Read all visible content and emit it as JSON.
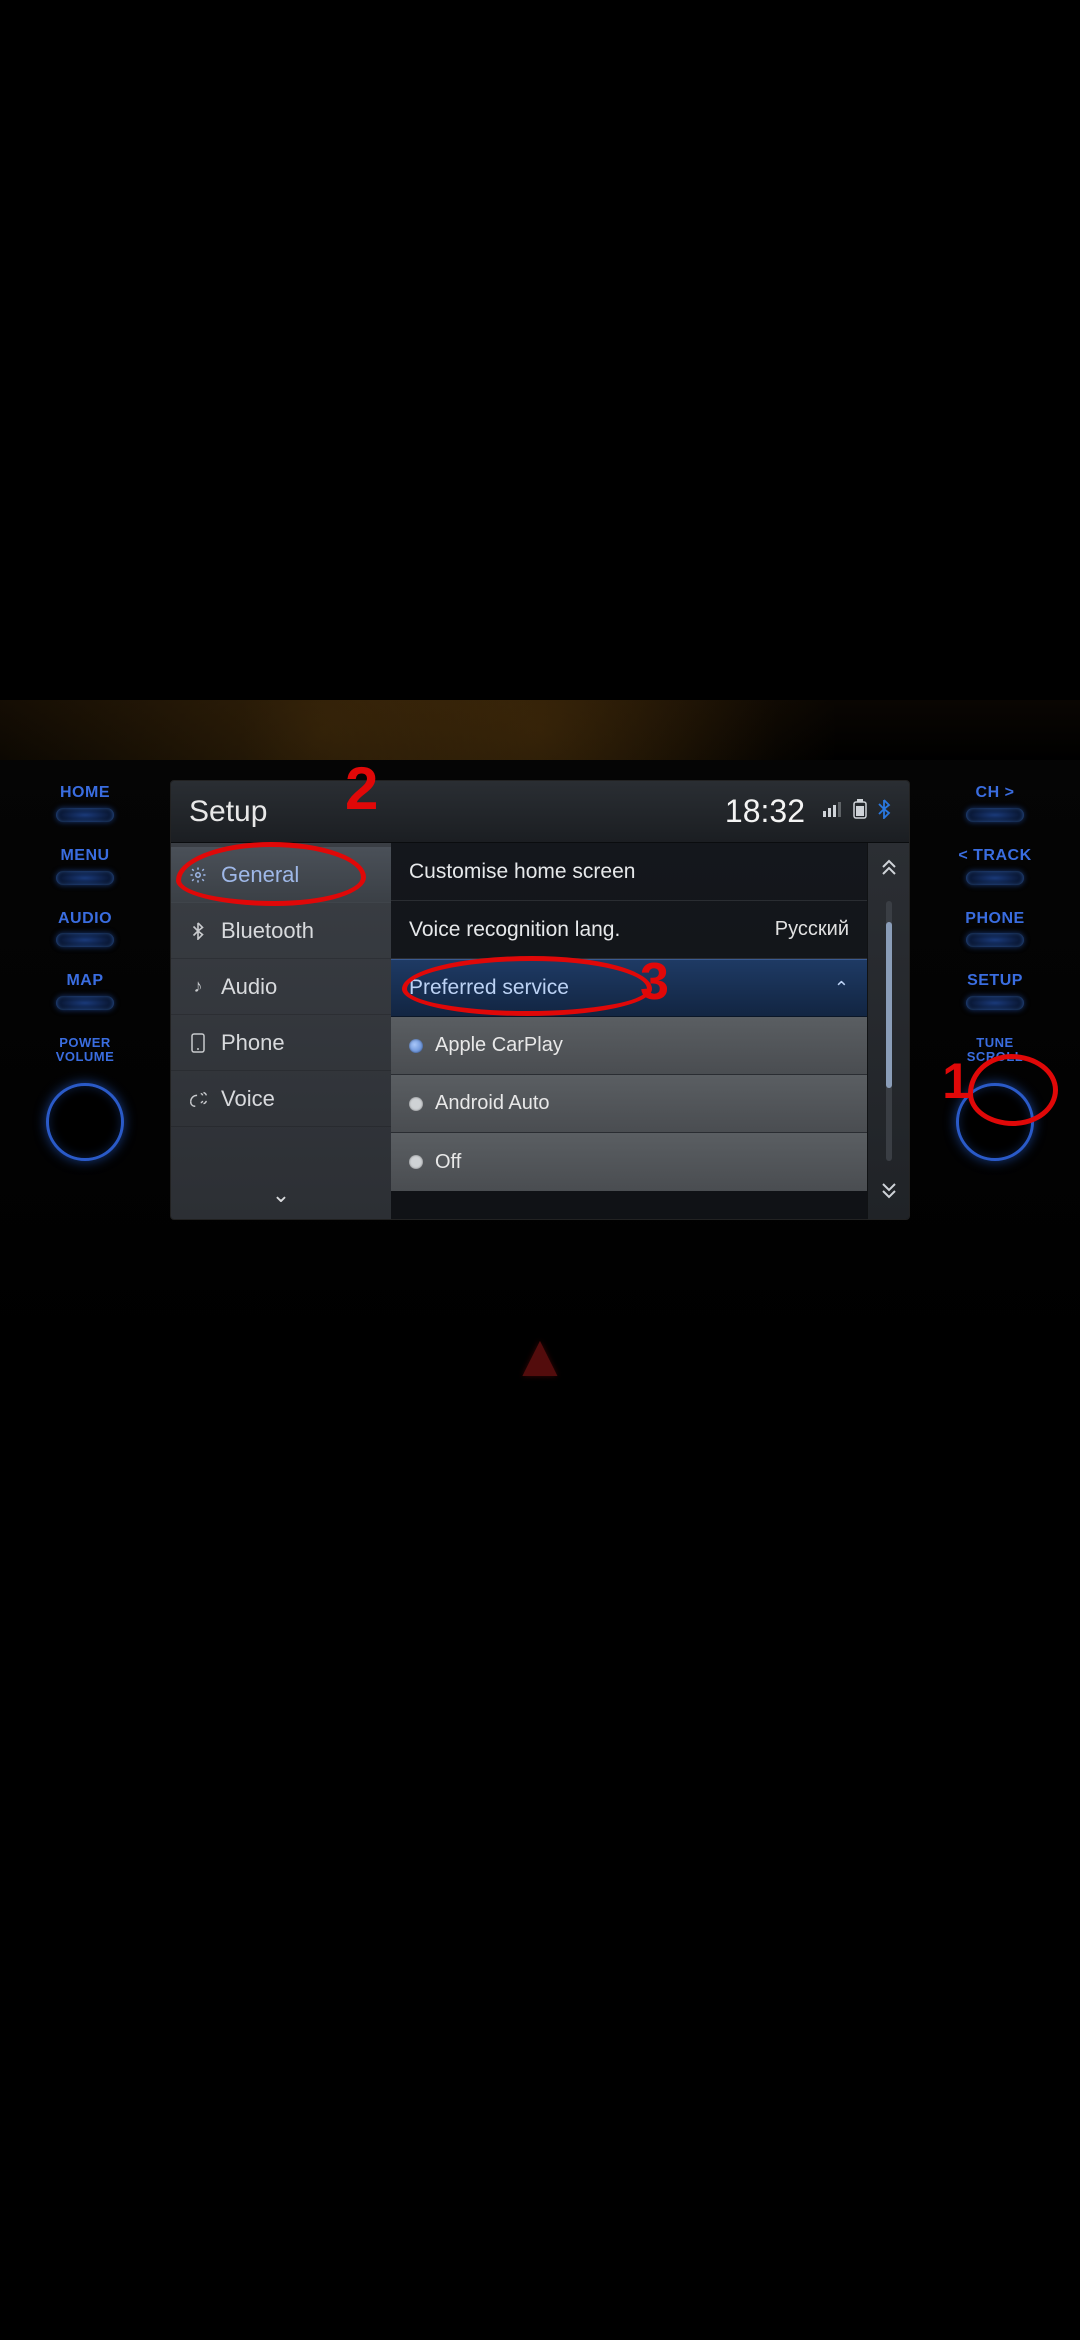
{
  "physical": {
    "left": [
      {
        "label": "HOME"
      },
      {
        "label": "MENU"
      },
      {
        "label": "AUDIO"
      },
      {
        "label": "MAP"
      }
    ],
    "left_knob": "POWER\nVOLUME",
    "right": [
      {
        "label": "CH >"
      },
      {
        "label": "< TRACK"
      },
      {
        "label": "PHONE"
      },
      {
        "label": "SETUP"
      }
    ],
    "right_knob": "TUNE\nSCROLL"
  },
  "screen": {
    "title": "Setup",
    "clock": "18:32",
    "sidebar": [
      {
        "icon": "gear",
        "label": "General",
        "selected": true
      },
      {
        "icon": "bluetooth",
        "label": "Bluetooth"
      },
      {
        "icon": "note",
        "label": "Audio"
      },
      {
        "icon": "phone",
        "label": "Phone"
      },
      {
        "icon": "voice",
        "label": "Voice"
      }
    ],
    "content": {
      "rows": [
        {
          "type": "link",
          "label": "Customise home screen"
        },
        {
          "type": "kv",
          "label": "Voice recognition lang.",
          "value": "Русский"
        },
        {
          "type": "expand",
          "label": "Preferred service"
        },
        {
          "type": "radio",
          "label": "Apple CarPlay",
          "checked": true
        },
        {
          "type": "radio",
          "label": "Android Auto",
          "checked": false
        },
        {
          "type": "radio",
          "label": "Off",
          "checked": false
        }
      ]
    }
  },
  "annotations": {
    "n1": "1",
    "n2": "2",
    "n3": "3"
  }
}
